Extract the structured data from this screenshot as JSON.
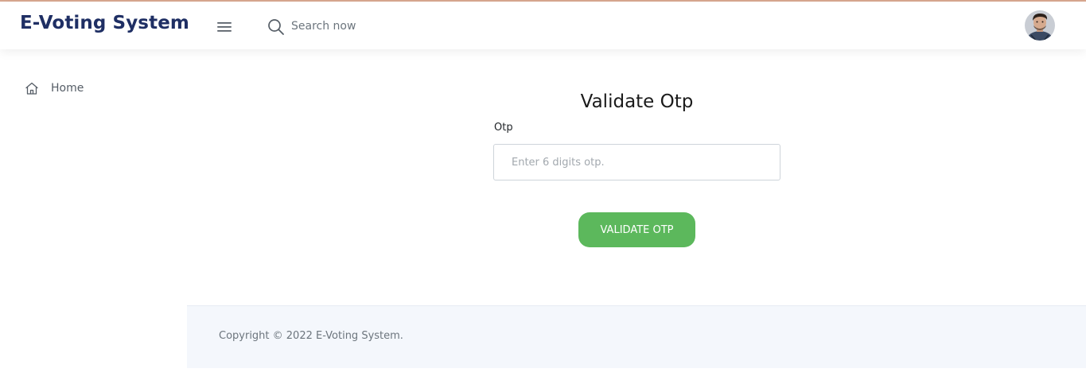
{
  "header": {
    "brand": "E-Voting System",
    "menu_icon": "hamburger-menu-icon",
    "search": {
      "icon": "search-icon",
      "placeholder": "Search now",
      "value": ""
    },
    "avatar_icon": "user-avatar"
  },
  "sidebar": {
    "items": [
      {
        "label": "Home",
        "icon": "home-icon"
      }
    ]
  },
  "main": {
    "title": "Validate Otp",
    "otp_field": {
      "label": "Otp",
      "placeholder": "Enter 6 digits otp.",
      "value": ""
    },
    "submit_label": "VALIDATE OTP"
  },
  "footer": {
    "copyright": "Copyright © 2022 E-Voting System."
  },
  "colors": {
    "brand": "#1f2f64",
    "button": "#5cb85c",
    "footer_bg": "#f4f7fc",
    "top_border": "#d9a890"
  }
}
